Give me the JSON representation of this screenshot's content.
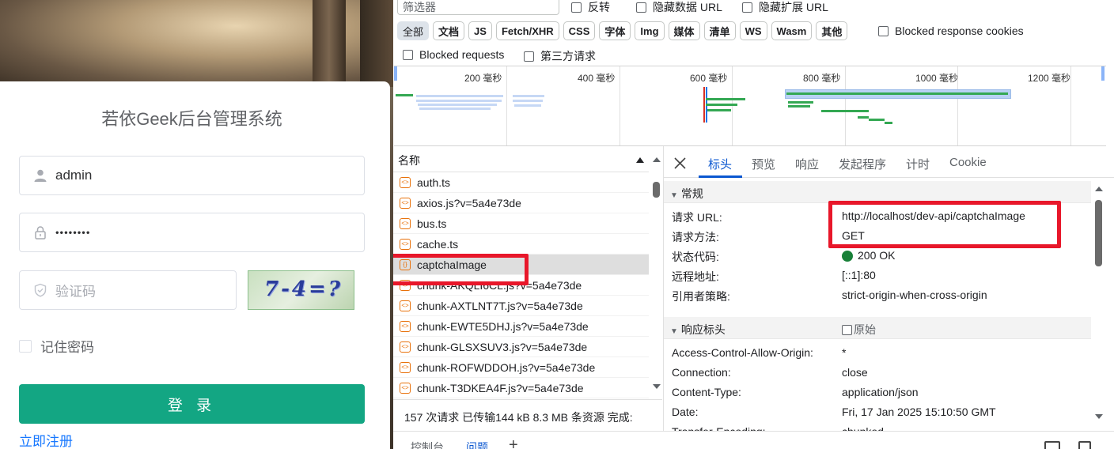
{
  "login": {
    "title": "若依Geek后台管理系统",
    "username_value": "admin",
    "password_value": "••••••••",
    "code_placeholder": "验证码",
    "captcha_text": "7-4=?",
    "remember_label": "记住密码",
    "login_button": "登 录",
    "register_link": "立即注册",
    "accent_color": "#13a683"
  },
  "devtools": {
    "filter_placeholder": "筛选器",
    "invert_label": "反转",
    "hide_data_url_label": "隐藏数据 URL",
    "hide_ext_url_label": "隐藏扩展 URL",
    "type_filters": [
      "全部",
      "文档",
      "JS",
      "Fetch/XHR",
      "CSS",
      "字体",
      "Img",
      "媒体",
      "清单",
      "WS",
      "Wasm",
      "其他"
    ],
    "blocked_response_cookies": "Blocked response cookies",
    "blocked_requests": "Blocked requests",
    "third_party": "第三方请求",
    "timeline_labels": [
      "200 毫秒",
      "400 毫秒",
      "600 毫秒",
      "800 毫秒",
      "1000 毫秒",
      "1200 毫秒"
    ],
    "name_header": "名称",
    "requests": [
      "auth.ts",
      "axios.js?v=5a4e73de",
      "bus.ts",
      "cache.ts",
      "captchaImage",
      "chunk-AKQLI6CL.js?v=5a4e73de",
      "chunk-AXTLNT7T.js?v=5a4e73de",
      "chunk-EWTE5DHJ.js?v=5a4e73de",
      "chunk-GLSXSUV3.js?v=5a4e73de",
      "chunk-ROFWDDOH.js?v=5a4e73de",
      "chunk-T3DKEA4F.js?v=5a4e73de"
    ],
    "selected_request": "captchaImage",
    "status_bar": "157 次请求  已传输144 kB  8.3 MB 条资源  完成:",
    "detail_tabs": [
      "标头",
      "预览",
      "响应",
      "发起程序",
      "计时",
      "Cookie"
    ],
    "general_section": "常规",
    "general": [
      {
        "key": "请求 URL:",
        "value": "http://localhost/dev-api/captchaImage"
      },
      {
        "key": "请求方法:",
        "value": "GET"
      },
      {
        "key": "状态代码:",
        "value": "200 OK"
      },
      {
        "key": "远程地址:",
        "value": "[::1]:80"
      },
      {
        "key": "引用者策略:",
        "value": "strict-origin-when-cross-origin"
      }
    ],
    "response_headers_section": "响应标头",
    "raw_label": "原始",
    "response_headers": [
      {
        "key": "Access-Control-Allow-Origin:",
        "value": "*"
      },
      {
        "key": "Connection:",
        "value": "close"
      },
      {
        "key": "Content-Type:",
        "value": "application/json"
      },
      {
        "key": "Date:",
        "value": "Fri, 17 Jan 2025 15:10:50 GMT"
      },
      {
        "key": "Transfer-Encoding:",
        "value": "chunked"
      }
    ],
    "drawer_tabs": [
      "控制台",
      "问题"
    ],
    "status_ok_color": "#188038",
    "highlight_color": "#e8172a"
  }
}
